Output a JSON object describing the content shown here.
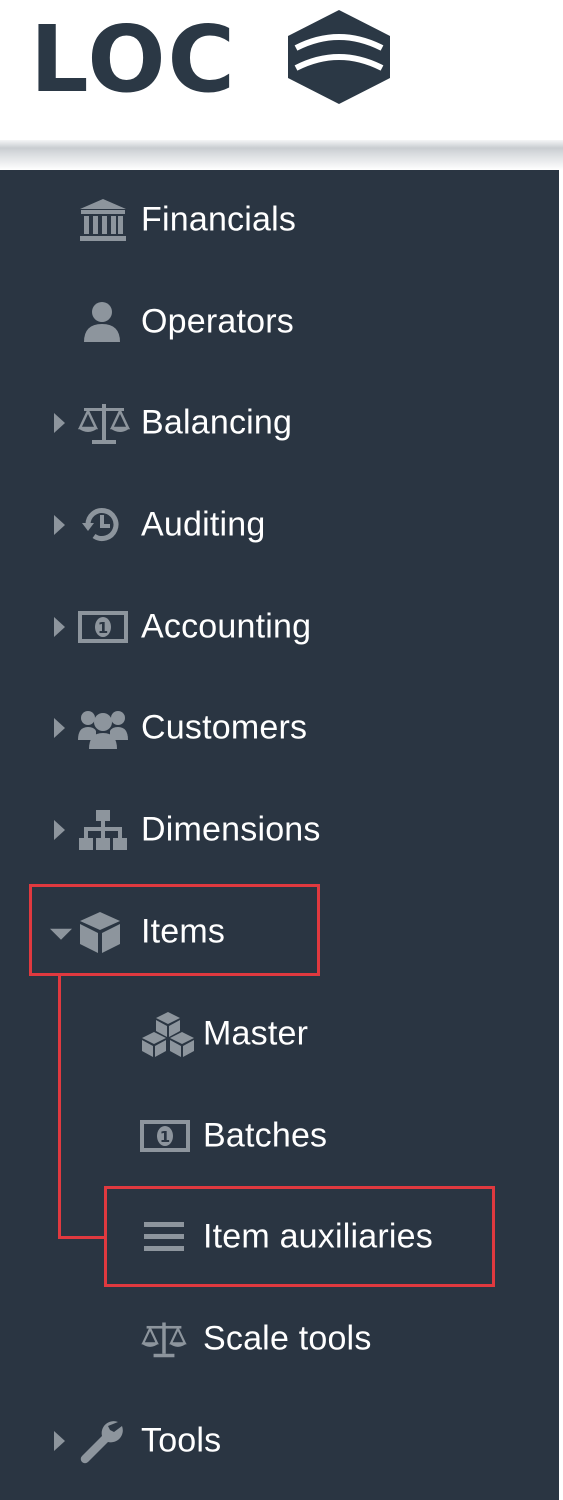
{
  "logo": {
    "text": "LOC"
  },
  "nav": {
    "financials": "Financials",
    "operators": "Operators",
    "balancing": "Balancing",
    "auditing": "Auditing",
    "accounting": "Accounting",
    "customers": "Customers",
    "dimensions": "Dimensions",
    "items": "Items",
    "master": "Master",
    "batches": "Batches",
    "item_auxiliaries": "Item auxiliaries",
    "scale_tools": "Scale tools",
    "tools": "Tools"
  },
  "icons": {
    "financials": "bank-icon",
    "operators": "user-icon",
    "balancing": "scale-icon",
    "auditing": "history-icon",
    "accounting": "money-icon",
    "customers": "users-icon",
    "dimensions": "sitemap-icon",
    "items": "cube-icon",
    "master": "cubes-icon",
    "batches": "money-icon",
    "item_auxiliaries": "bars-icon",
    "scale_tools": "scale-icon",
    "tools": "wrench-icon"
  },
  "colors": {
    "sidebar_bg": "#2a3542",
    "icon_gray": "#8d959d",
    "highlight": "#e0393f",
    "logo": "#2b3845"
  }
}
